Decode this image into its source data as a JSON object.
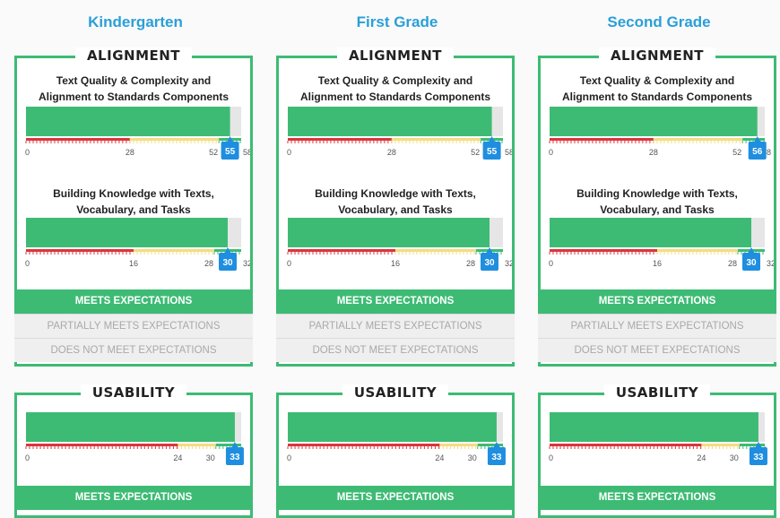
{
  "columns": [
    {
      "title": "Kindergarten",
      "alignment": {
        "heading": "ALIGNMENT",
        "ratings": [
          "MEETS EXPECTATIONS",
          "PARTIALLY MEETS EXPECTATIONS",
          "DOES NOT MEET EXPECTATIONS"
        ]
      },
      "usability": {
        "heading": "USABILITY",
        "rating": "MEETS EXPECTATIONS"
      }
    },
    {
      "title": "First Grade",
      "alignment": {
        "heading": "ALIGNMENT",
        "ratings": [
          "MEETS EXPECTATIONS",
          "PARTIALLY MEETS EXPECTATIONS",
          "DOES NOT MEET EXPECTATIONS"
        ]
      },
      "usability": {
        "heading": "USABILITY",
        "rating": "MEETS EXPECTATIONS"
      }
    },
    {
      "title": "Second Grade",
      "alignment": {
        "heading": "ALIGNMENT",
        "ratings": [
          "MEETS EXPECTATIONS",
          "PARTIALLY MEETS EXPECTATIONS",
          "DOES NOT MEET EXPECTATIONS"
        ]
      },
      "usability": {
        "heading": "USABILITY",
        "rating": "MEETS EXPECTATIONS"
      }
    }
  ],
  "colors": {
    "title_blue": "#2a9fd8",
    "green": "#3dbb74",
    "red": "#d9363e",
    "yellow": "#f3dc82",
    "badge": "#1f8ee0",
    "track": "#e6e6e6"
  },
  "chart_data": [
    {
      "type": "bar",
      "column": "Kindergarten",
      "section": "ALIGNMENT",
      "title": "Text Quality & Complexity and Alignment to Standards Components",
      "value": 55,
      "max": 58,
      "bands": [
        {
          "from": 0,
          "to": 28,
          "color": "red"
        },
        {
          "from": 28,
          "to": 52,
          "color": "yellow"
        },
        {
          "from": 52,
          "to": 58,
          "color": "green"
        }
      ],
      "ticks": [
        "0",
        "28",
        "52",
        "58"
      ]
    },
    {
      "type": "bar",
      "column": "Kindergarten",
      "section": "ALIGNMENT",
      "title": "Building Knowledge with Texts, Vocabulary, and Tasks",
      "value": 30,
      "max": 32,
      "bands": [
        {
          "from": 0,
          "to": 16,
          "color": "red"
        },
        {
          "from": 16,
          "to": 28,
          "color": "yellow"
        },
        {
          "from": 28,
          "to": 32,
          "color": "green"
        }
      ],
      "ticks": [
        "0",
        "16",
        "28",
        "32"
      ]
    },
    {
      "type": "bar",
      "column": "Kindergarten",
      "section": "USABILITY",
      "title": "",
      "value": 33,
      "max": 34,
      "bands": [
        {
          "from": 0,
          "to": 24,
          "color": "red"
        },
        {
          "from": 24,
          "to": 30,
          "color": "yellow"
        },
        {
          "from": 30,
          "to": 34,
          "color": "green"
        }
      ],
      "ticks": [
        "0",
        "24",
        "30",
        ""
      ]
    },
    {
      "type": "bar",
      "column": "First Grade",
      "section": "ALIGNMENT",
      "title": "Text Quality & Complexity and Alignment to Standards Components",
      "value": 55,
      "max": 58,
      "bands": [
        {
          "from": 0,
          "to": 28,
          "color": "red"
        },
        {
          "from": 28,
          "to": 52,
          "color": "yellow"
        },
        {
          "from": 52,
          "to": 58,
          "color": "green"
        }
      ],
      "ticks": [
        "0",
        "28",
        "52",
        "58"
      ]
    },
    {
      "type": "bar",
      "column": "First Grade",
      "section": "ALIGNMENT",
      "title": "Building Knowledge with Texts, Vocabulary, and Tasks",
      "value": 30,
      "max": 32,
      "bands": [
        {
          "from": 0,
          "to": 16,
          "color": "red"
        },
        {
          "from": 16,
          "to": 28,
          "color": "yellow"
        },
        {
          "from": 28,
          "to": 32,
          "color": "green"
        }
      ],
      "ticks": [
        "0",
        "16",
        "28",
        "32"
      ]
    },
    {
      "type": "bar",
      "column": "First Grade",
      "section": "USABILITY",
      "title": "",
      "value": 33,
      "max": 34,
      "bands": [
        {
          "from": 0,
          "to": 24,
          "color": "red"
        },
        {
          "from": 24,
          "to": 30,
          "color": "yellow"
        },
        {
          "from": 30,
          "to": 34,
          "color": "green"
        }
      ],
      "ticks": [
        "0",
        "24",
        "30",
        ""
      ]
    },
    {
      "type": "bar",
      "column": "Second Grade",
      "section": "ALIGNMENT",
      "title": "Text Quality & Complexity and Alignment to Standards Components",
      "value": 56,
      "max": 58,
      "bands": [
        {
          "from": 0,
          "to": 28,
          "color": "red"
        },
        {
          "from": 28,
          "to": 52,
          "color": "yellow"
        },
        {
          "from": 52,
          "to": 58,
          "color": "green"
        }
      ],
      "ticks": [
        "0",
        "28",
        "52",
        "8"
      ]
    },
    {
      "type": "bar",
      "column": "Second Grade",
      "section": "ALIGNMENT",
      "title": "Building Knowledge with Texts, Vocabulary, and Tasks",
      "value": 30,
      "max": 32,
      "bands": [
        {
          "from": 0,
          "to": 16,
          "color": "red"
        },
        {
          "from": 16,
          "to": 28,
          "color": "yellow"
        },
        {
          "from": 28,
          "to": 32,
          "color": "green"
        }
      ],
      "ticks": [
        "0",
        "16",
        "28",
        "32"
      ]
    },
    {
      "type": "bar",
      "column": "Second Grade",
      "section": "USABILITY",
      "title": "",
      "value": 33,
      "max": 34,
      "bands": [
        {
          "from": 0,
          "to": 24,
          "color": "red"
        },
        {
          "from": 24,
          "to": 30,
          "color": "yellow"
        },
        {
          "from": 30,
          "to": 34,
          "color": "green"
        }
      ],
      "ticks": [
        "0",
        "24",
        "30",
        ""
      ]
    }
  ]
}
